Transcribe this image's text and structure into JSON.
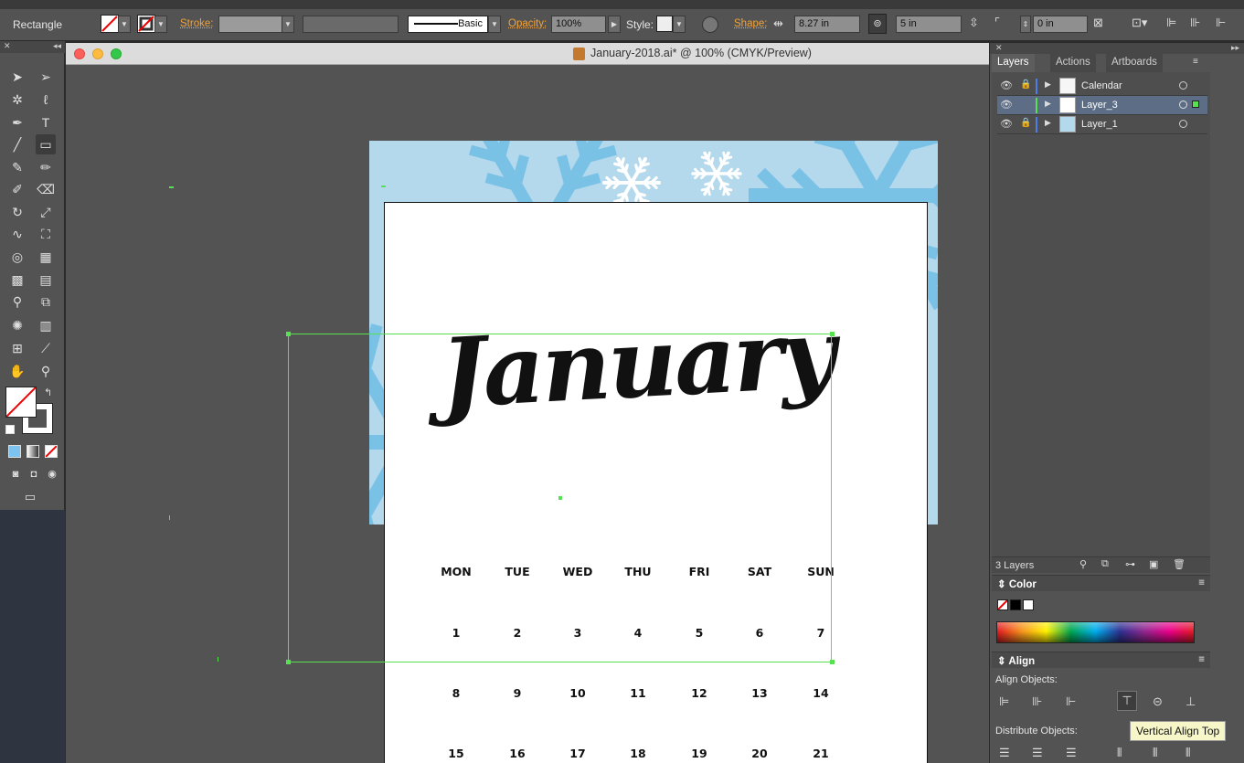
{
  "control_bar": {
    "tool_name": "Rectangle",
    "stroke_label": "Stroke:",
    "brush_label": "Basic",
    "opacity_label": "Opacity:",
    "opacity_value": "100%",
    "style_label": "Style:",
    "shape_label": "Shape:",
    "width_value": "8.27 in",
    "height_value": "5 in",
    "corner_value": "0 in"
  },
  "document": {
    "title": "January-2018.ai* @ 100% (CMYK/Preview)"
  },
  "artwork": {
    "month": "January",
    "weekdays": [
      "MON",
      "TUE",
      "WED",
      "THU",
      "FRI",
      "SAT",
      "SUN"
    ],
    "weeks": [
      [
        "1",
        "2",
        "3",
        "4",
        "5",
        "6",
        "7"
      ],
      [
        "8",
        "9",
        "10",
        "11",
        "12",
        "13",
        "14"
      ],
      [
        "15",
        "16",
        "17",
        "18",
        "19",
        "20",
        "21"
      ]
    ]
  },
  "layers_panel": {
    "tabs": [
      "Layers",
      "Actions",
      "Artboards"
    ],
    "layers": [
      "Calendar",
      "Layer_3",
      "Layer_1"
    ],
    "count": "3 Layers"
  },
  "color_panel": {
    "title": "Color"
  },
  "align_panel": {
    "title": "Align",
    "align_objects_label": "Align Objects:",
    "distribute_objects_label": "Distribute Objects:"
  },
  "tooltip": "Vertical Align Top",
  "colors": {
    "selection": "#57e04f",
    "pastel": "#b4d8ec",
    "flake_blue": "#79c2e6",
    "layer_selected": "#5d6d86",
    "panel_bg": "#535353"
  },
  "icons": [
    "selection-icon",
    "direct-selection-icon",
    "pen-icon",
    "type-icon",
    "rectangle-icon",
    "hand-icon",
    "zoom-icon",
    "eye-icon",
    "lock-icon",
    "search-icon",
    "trash-icon"
  ]
}
